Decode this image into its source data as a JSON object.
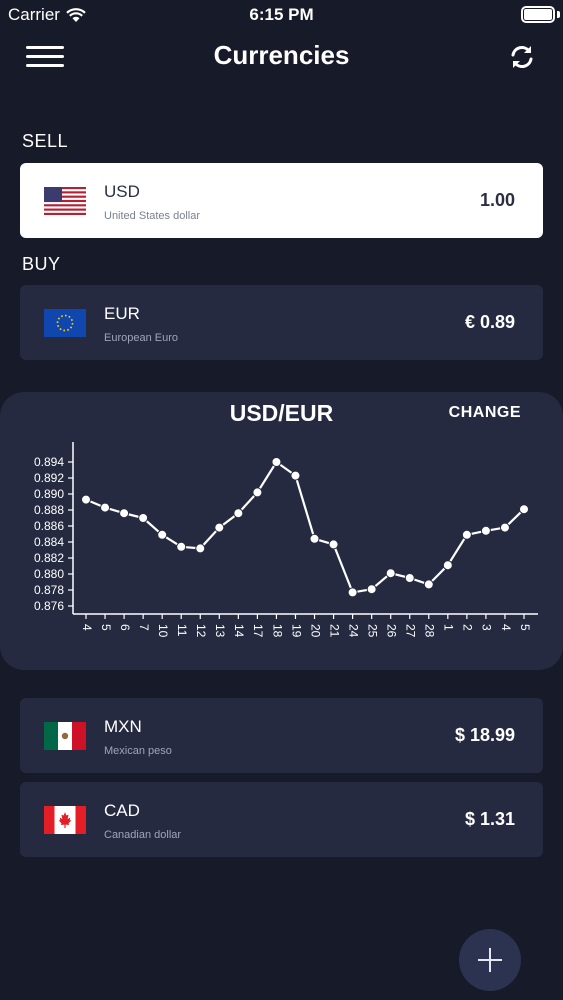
{
  "status": {
    "carrier": "Carrier",
    "time": "6:15 PM"
  },
  "header": {
    "title": "Currencies"
  },
  "sell": {
    "label": "SELL",
    "code": "USD",
    "name": "United States dollar",
    "value": "1.00"
  },
  "buy": {
    "label": "BUY",
    "code": "EUR",
    "name": "European Euro",
    "value": "€ 0.89"
  },
  "chart_panel": {
    "title": "USD/EUR",
    "change_label": "CHANGE"
  },
  "chart_data": {
    "type": "line",
    "title": "USD/EUR",
    "categories": [
      "4",
      "5",
      "6",
      "7",
      "10",
      "11",
      "12",
      "13",
      "14",
      "17",
      "18",
      "19",
      "20",
      "21",
      "24",
      "25",
      "26",
      "27",
      "28",
      "1",
      "2",
      "3",
      "4",
      "5"
    ],
    "values": [
      0.8893,
      0.8883,
      0.8876,
      0.887,
      0.8849,
      0.8834,
      0.8832,
      0.8858,
      0.8876,
      0.8902,
      0.894,
      0.8923,
      0.8844,
      0.8837,
      0.8777,
      0.8781,
      0.8801,
      0.8795,
      0.8787,
      0.8811,
      0.8849,
      0.8854,
      0.8858,
      0.8881
    ],
    "y_ticks": [
      "0.876",
      "0.878",
      "0.880",
      "0.882",
      "0.884",
      "0.886",
      "0.888",
      "0.890",
      "0.892",
      "0.894"
    ],
    "ylim": [
      0.875,
      0.8965
    ],
    "grid": false
  },
  "others": [
    {
      "code": "MXN",
      "name": "Mexican peso",
      "value": "$ 18.99"
    },
    {
      "code": "CAD",
      "name": "Canadian dollar",
      "value": "$ 1.31"
    }
  ],
  "colors": {
    "background": "#171a28",
    "card": "#252a40",
    "accent": "#ffffff"
  }
}
